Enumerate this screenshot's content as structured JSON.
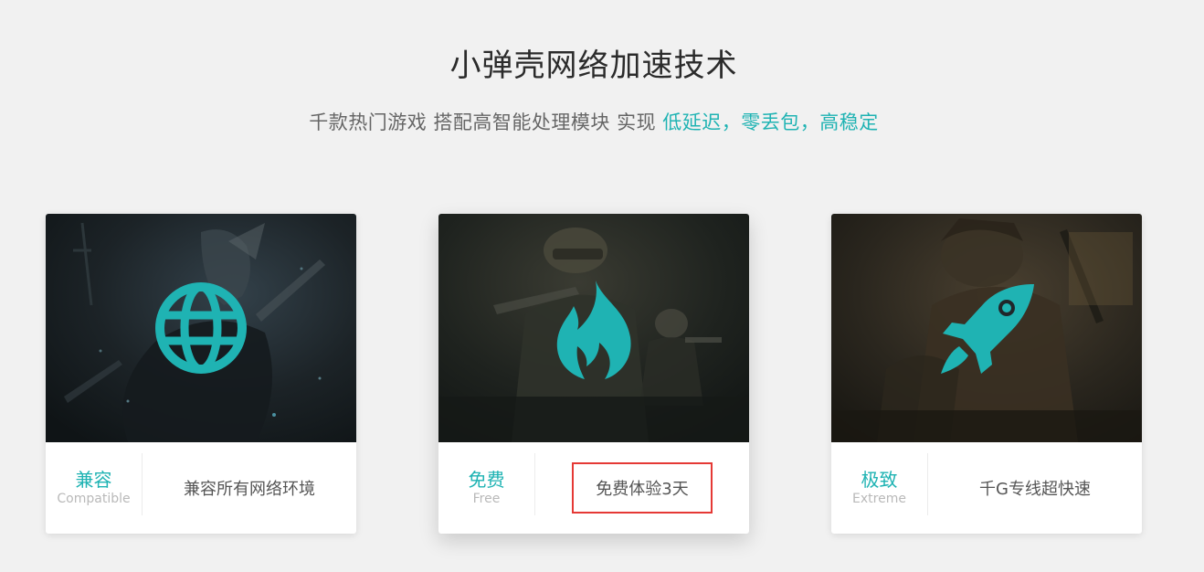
{
  "header": {
    "title": "小弹壳网络加速技术",
    "subtitle_prefix": "千款热门游戏 搭配高智能处理模块 实现 ",
    "subtitle_highlight": "低延迟，零丢包，高稳定"
  },
  "colors": {
    "accent": "#1fb3b3",
    "background": "#f1f1f1",
    "highlight_border": "#e53935"
  },
  "cards": [
    {
      "icon": "globe-icon",
      "tag_cn": "兼容",
      "tag_en": "Compatible",
      "desc": "兼容所有网络环境"
    },
    {
      "icon": "flame-icon",
      "tag_cn": "免费",
      "tag_en": "Free",
      "desc": "免费体验3天"
    },
    {
      "icon": "rocket-icon",
      "tag_cn": "极致",
      "tag_en": "Extreme",
      "desc": "千G专线超快速"
    }
  ]
}
